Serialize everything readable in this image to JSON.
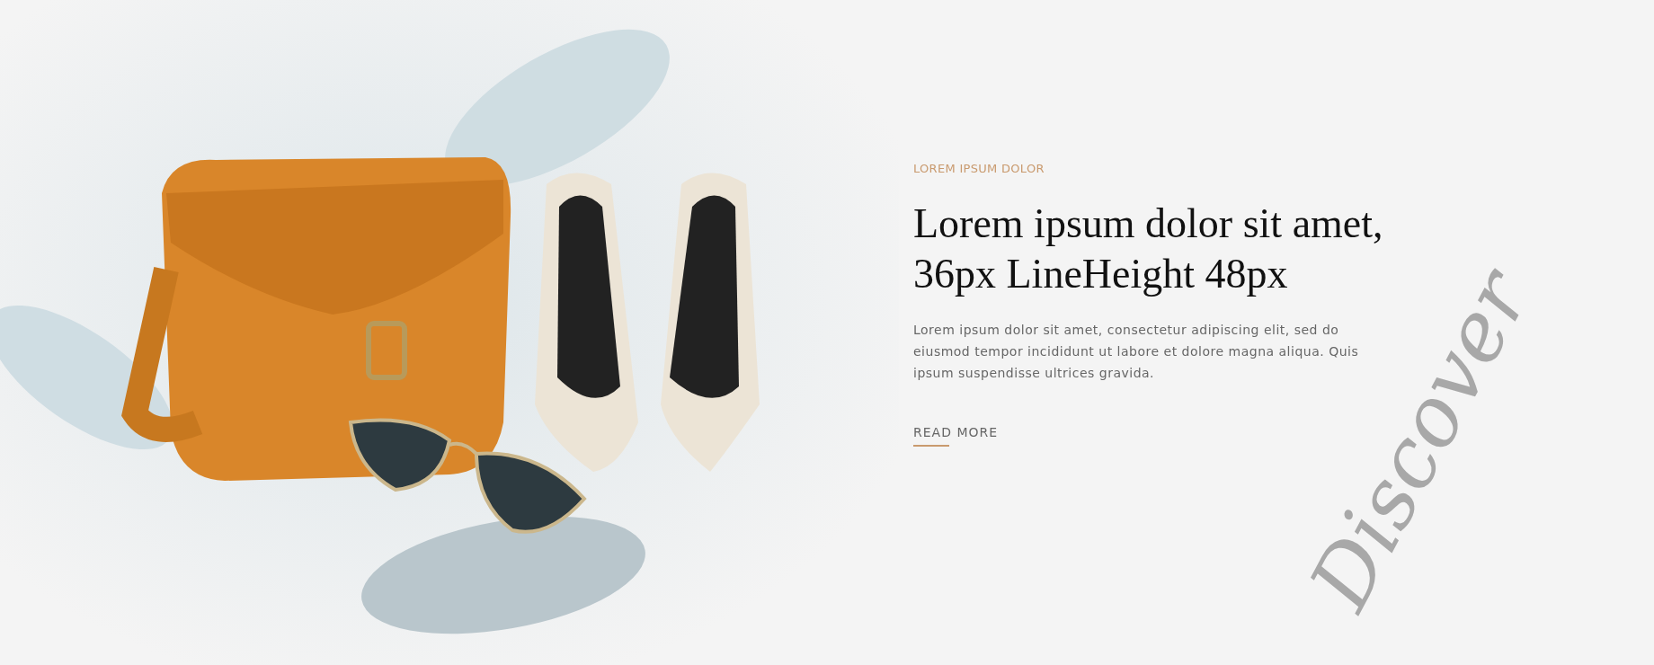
{
  "hero": {
    "eyebrow": "LOREM IPSUM DOLOR",
    "heading_lines": [
      "Lorem ipsum dolor sit amet,",
      "36px LineHeight 48px"
    ],
    "body": "Lorem ipsum dolor sit amet, consectetur adipiscing elit, sed do eiusmod tempor incididunt ut labore et dolore magna aliqua. Quis ipsum suspendisse ultrices gravida.",
    "link": "READ MORE",
    "script_word": "Discover"
  }
}
